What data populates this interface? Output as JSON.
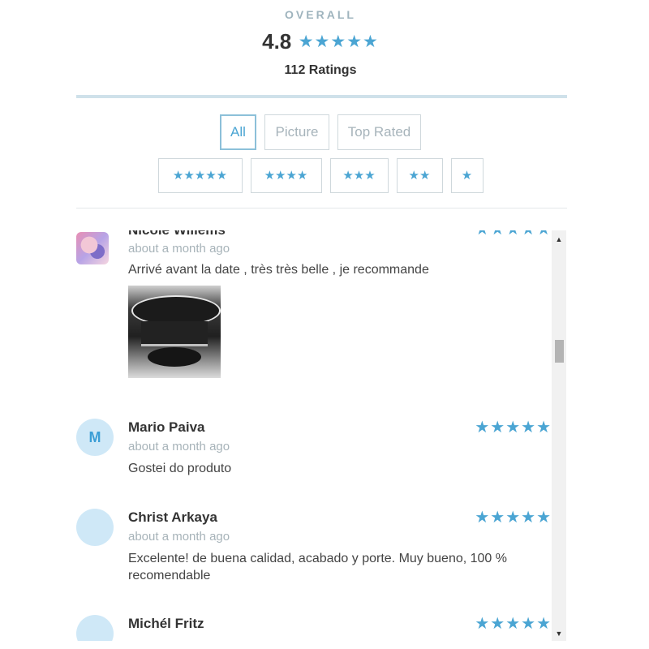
{
  "summary": {
    "overall_label": "OVERALL",
    "rating_value": "4.8",
    "rating_stars": "★★★★★",
    "rating_count": "112 Ratings"
  },
  "filters": {
    "type": [
      {
        "label": "All",
        "active": true
      },
      {
        "label": "Picture",
        "active": false
      },
      {
        "label": "Top Rated",
        "active": false
      }
    ],
    "stars": [
      "★★★★★",
      "★★★★",
      "★★★",
      "★★",
      "★"
    ]
  },
  "reviews": [
    {
      "name": "Nicole Willems",
      "date": "about a month ago",
      "text": "Arrivé avant la date , très très belle , je recommande",
      "stars": "★★★★★",
      "avatar": "photo",
      "has_photo": true
    },
    {
      "name": "Mario Paiva",
      "date": "about a month ago",
      "text": "Gostei do produto",
      "stars": "★★★★★",
      "avatar": "M",
      "has_photo": false
    },
    {
      "name": "Christ Arkaya",
      "date": "about a month ago",
      "text": "Excelente! de buena calidad, acabado y porte. Muy bueno, 100 % recomendable",
      "stars": "★★★★★",
      "avatar": "",
      "has_photo": false
    },
    {
      "name": "Michél Fritz",
      "date": "",
      "text": "",
      "stars": "★★★★★",
      "avatar": "",
      "has_photo": false
    }
  ],
  "colors": {
    "accent": "#4ba5d3",
    "avatar_bg": "#cfe8f7",
    "muted_text": "#a7b3b9",
    "divider": "#cfe1ea"
  },
  "icons": {
    "star": "star-icon",
    "scroll_up": "scroll-up-arrow-icon",
    "scroll_down": "scroll-down-arrow-icon"
  }
}
